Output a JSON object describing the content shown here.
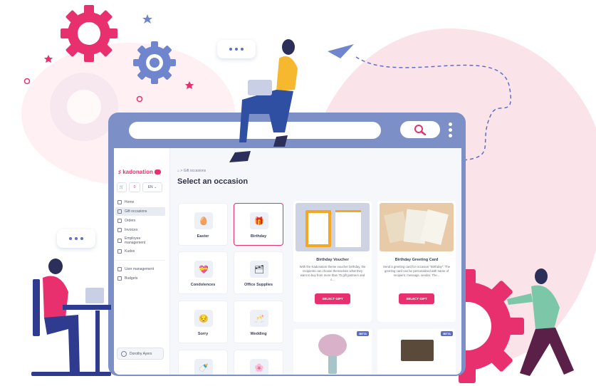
{
  "colors": {
    "accent": "#e8306f",
    "frame": "#7d8fc7",
    "gear_blue": "#6f86cf",
    "gear_pink": "#e8306f",
    "beta": "#5d6fc4"
  },
  "browser": {
    "search_icon": "search-icon",
    "menu_icon": "vertical-dots-icon"
  },
  "sidebar": {
    "brand": "kadonation",
    "cart_icon": "cart-icon",
    "cart_count": "0",
    "language": "EN",
    "items": [
      {
        "label": "Home",
        "icon": "home-icon",
        "active": false
      },
      {
        "label": "Gift occasions",
        "icon": "gift-icon",
        "active": true
      },
      {
        "label": "Orders",
        "icon": "orders-icon",
        "active": false
      },
      {
        "label": "Invoices",
        "icon": "invoice-icon",
        "active": false
      },
      {
        "label": "Employee management",
        "icon": "employees-icon",
        "active": false
      },
      {
        "label": "Kudos",
        "icon": "kudos-icon",
        "active": false
      },
      {
        "label": "User management",
        "icon": "user-icon",
        "active": false
      },
      {
        "label": "Budgets",
        "icon": "budget-icon",
        "active": false
      }
    ],
    "user_name": "Dorothy Ayers"
  },
  "main": {
    "breadcrumb": {
      "home_icon": "home-icon",
      "separator": ">",
      "current": "Gift occasions"
    },
    "title": "Select an occasion",
    "occasions": [
      {
        "label": "Easter",
        "icon": "🥚",
        "selected": false
      },
      {
        "label": "Birthday",
        "icon": "🎁",
        "selected": true
      },
      {
        "label": "Condolences",
        "icon": "💝",
        "selected": false
      },
      {
        "label": "Office Supplies",
        "icon": "🗂",
        "selected": false
      },
      {
        "label": "Sorry",
        "icon": "😔",
        "selected": false
      },
      {
        "label": "Wedding",
        "icon": "🥂",
        "selected": false
      },
      {
        "label": "",
        "icon": "🍼",
        "selected": false
      },
      {
        "label": "",
        "icon": "🌸",
        "selected": false
      }
    ],
    "gifts": [
      {
        "title": "Birthday Voucher",
        "desc": "With the Kadonation theme voucher birthday, the recipients can choose themselves what they want to buy from more than 75 gift partners and c...",
        "button": "SELECT GIFT"
      },
      {
        "title": "Birthday Greeting Card",
        "desc": "Send a greeting card for occasion \"Birthday\". The greeting card can be personalized with name of recipient, message, sender. The...",
        "button": "SELECT GIFT"
      },
      {
        "badge": "BETA"
      },
      {
        "badge": "BETA"
      }
    ]
  }
}
